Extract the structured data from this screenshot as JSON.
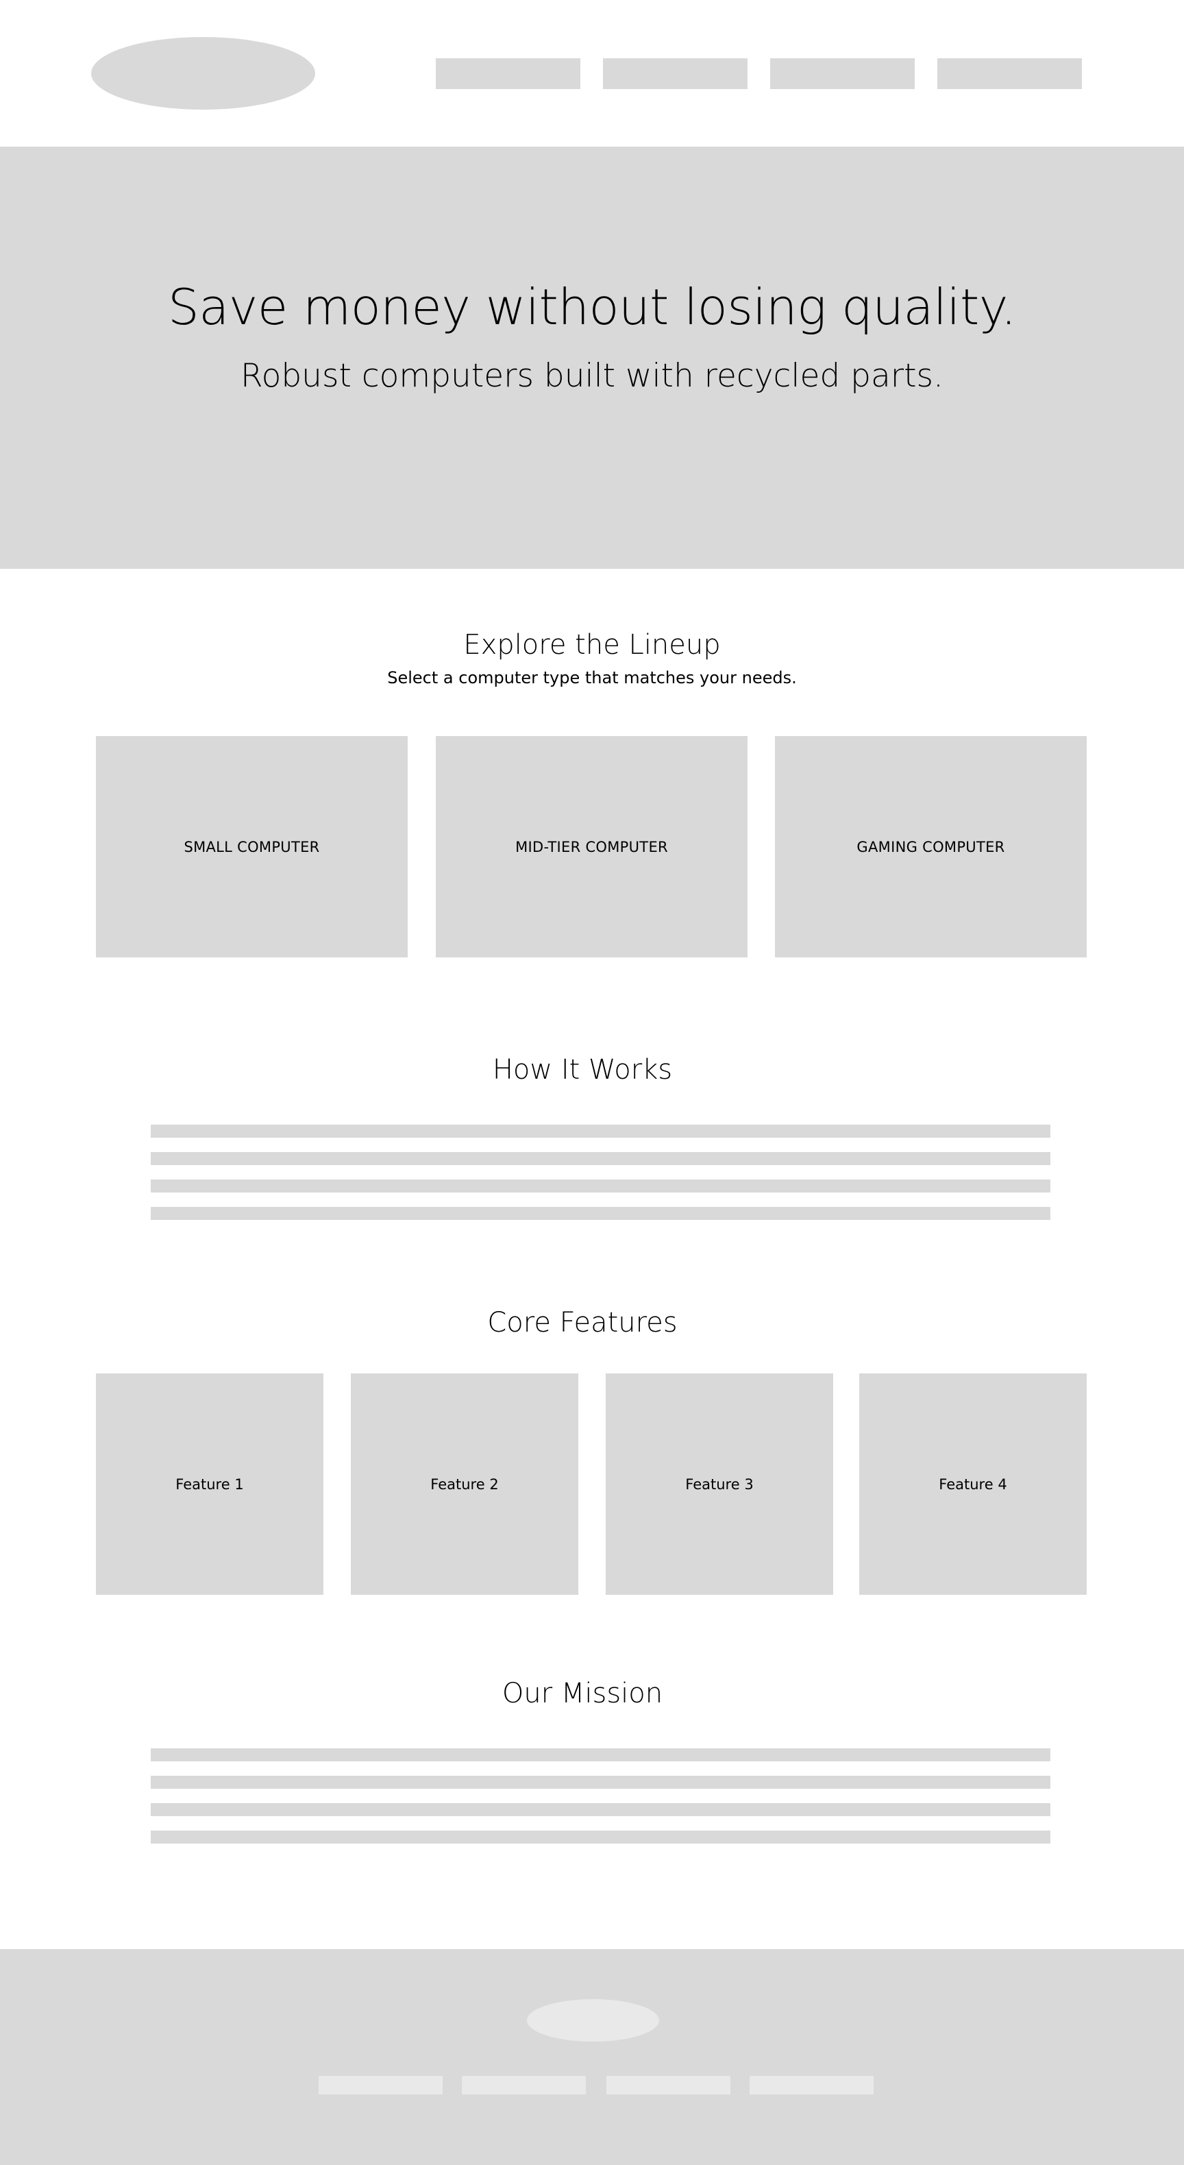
{
  "header": {
    "logo": "logo-placeholder",
    "nav": [
      {
        "label": ""
      },
      {
        "label": ""
      },
      {
        "label": ""
      },
      {
        "label": ""
      }
    ]
  },
  "hero": {
    "title": "Save money without losing quality.",
    "subtitle": "Robust computers built with recycled parts."
  },
  "lineup": {
    "title": "Explore the Lineup",
    "subtitle": "Select a computer type that matches your needs.",
    "cards": [
      {
        "label": "SMALL COMPUTER"
      },
      {
        "label": "MID-TIER COMPUTER"
      },
      {
        "label": "GAMING COMPUTER"
      }
    ]
  },
  "how_it_works": {
    "title": "How It Works",
    "lines": 4
  },
  "features": {
    "title": "Core Features",
    "items": [
      {
        "label": "Feature 1"
      },
      {
        "label": "Feature 2"
      },
      {
        "label": "Feature 3"
      },
      {
        "label": "Feature 4"
      }
    ]
  },
  "mission": {
    "title": "Our Mission",
    "lines": 4
  },
  "footer": {
    "logo": "footer-logo-placeholder",
    "links": [
      {
        "label": ""
      },
      {
        "label": ""
      },
      {
        "label": ""
      },
      {
        "label": ""
      }
    ]
  },
  "colors": {
    "placeholder": "#d9d9d9",
    "footer_placeholder": "#e9e9e9",
    "background": "#ffffff",
    "text": "#000000"
  }
}
